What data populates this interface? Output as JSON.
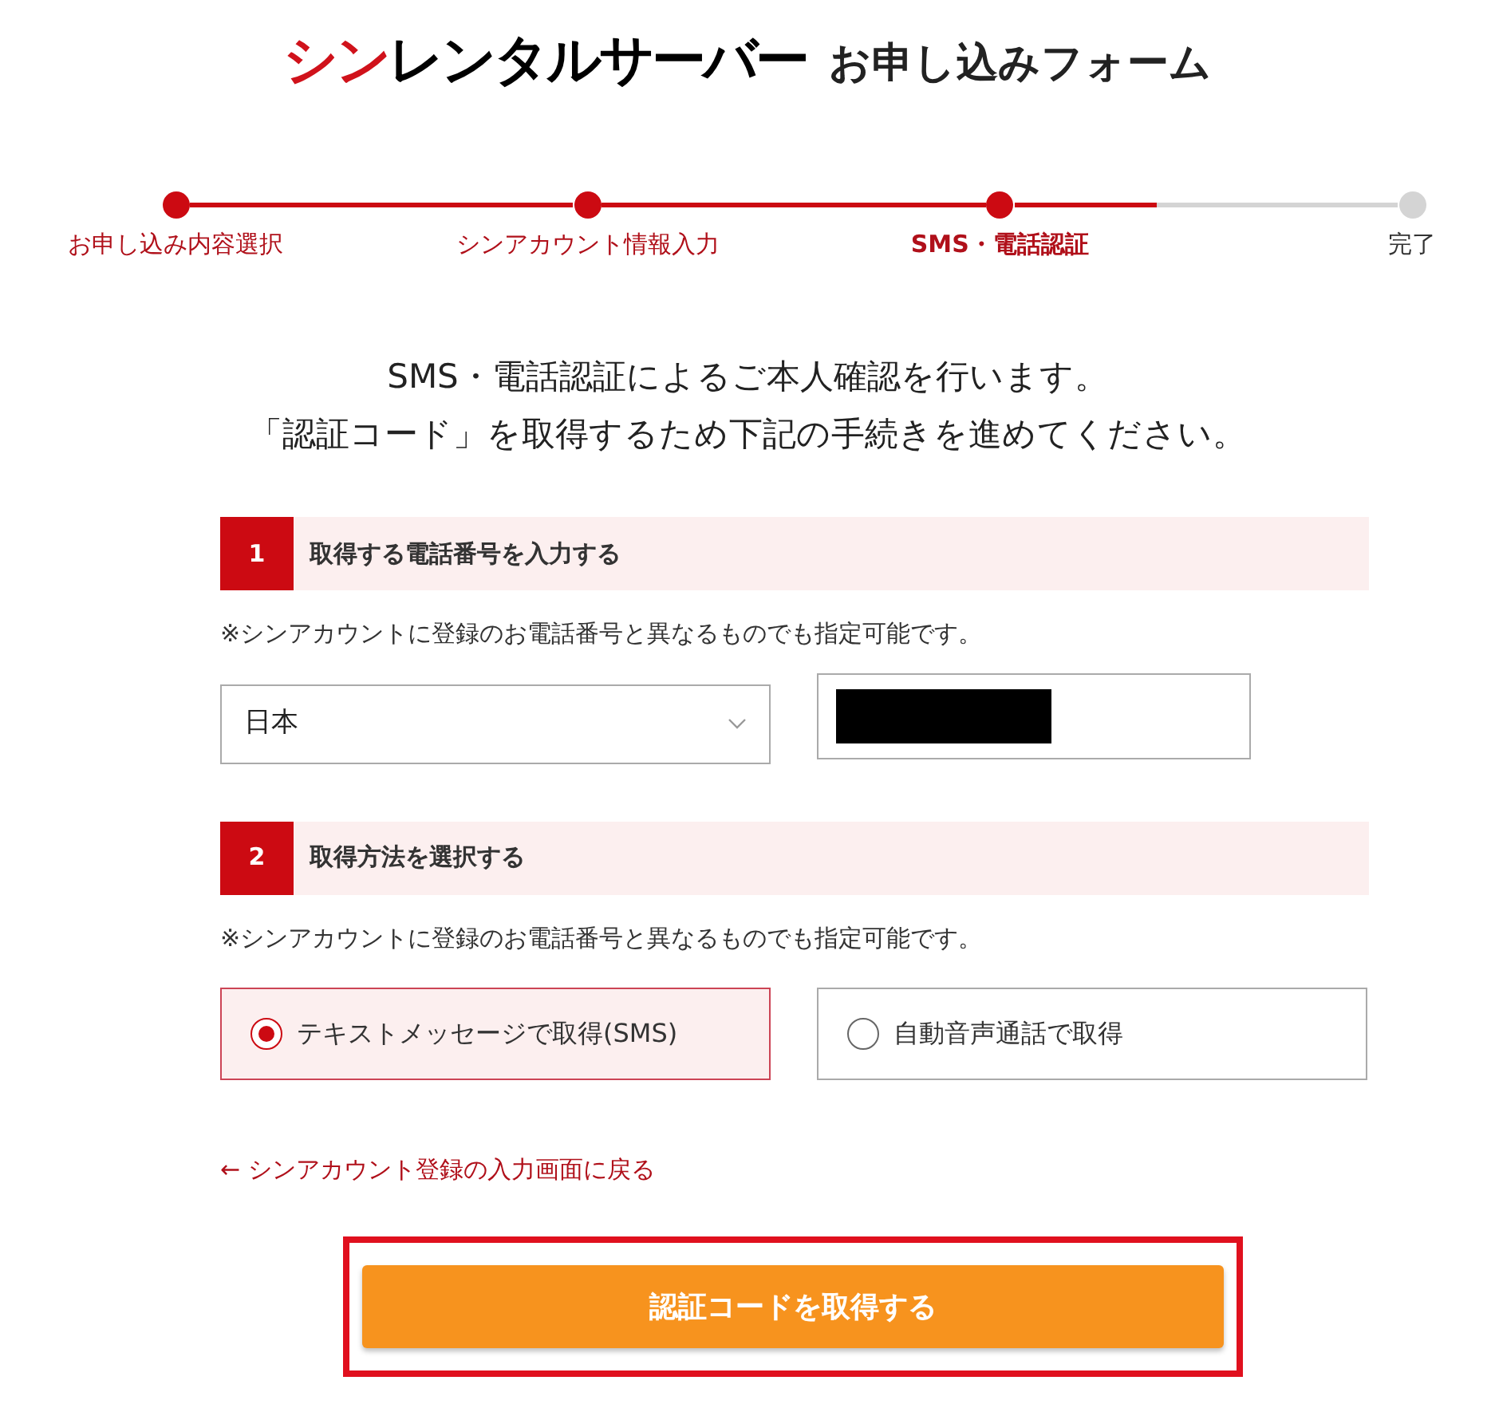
{
  "header": {
    "logo_accent": "シン",
    "logo_rest": "レンタルサーバー",
    "title": "お申し込みフォーム"
  },
  "steps": [
    {
      "label": "お申し込み内容選択",
      "reached": true,
      "selected": false
    },
    {
      "label": "シンアカウント情報入力",
      "reached": true,
      "selected": false
    },
    {
      "label": "SMS・電話認証",
      "reached": true,
      "selected": true
    },
    {
      "label": "完了",
      "reached": false,
      "selected": false
    }
  ],
  "intro": [
    "SMS・電話認証によるご本人確認を行います。",
    "「認証コード」を取得するため下記の手続きを進めてください。"
  ],
  "sections": [
    {
      "number": "1",
      "title": "取得する電話番号を入力する",
      "note": "※シンアカウントに登録のお電話番号と異なるものでも指定可能です。",
      "kind": "phone",
      "country": "日本"
    },
    {
      "number": "2",
      "title": "取得方法を選択する",
      "note": "※シンアカウントに登録のお電話番号と異なるものでも指定可能です。",
      "kind": "method",
      "options": [
        {
          "label": "テキストメッセージで取得(SMS)",
          "selected": true
        },
        {
          "label": "自動音声通話で取得",
          "selected": false
        }
      ]
    }
  ],
  "back_link": "← シンアカウント登録の入力画面に戻る",
  "submit": "認証コードを取得する"
}
